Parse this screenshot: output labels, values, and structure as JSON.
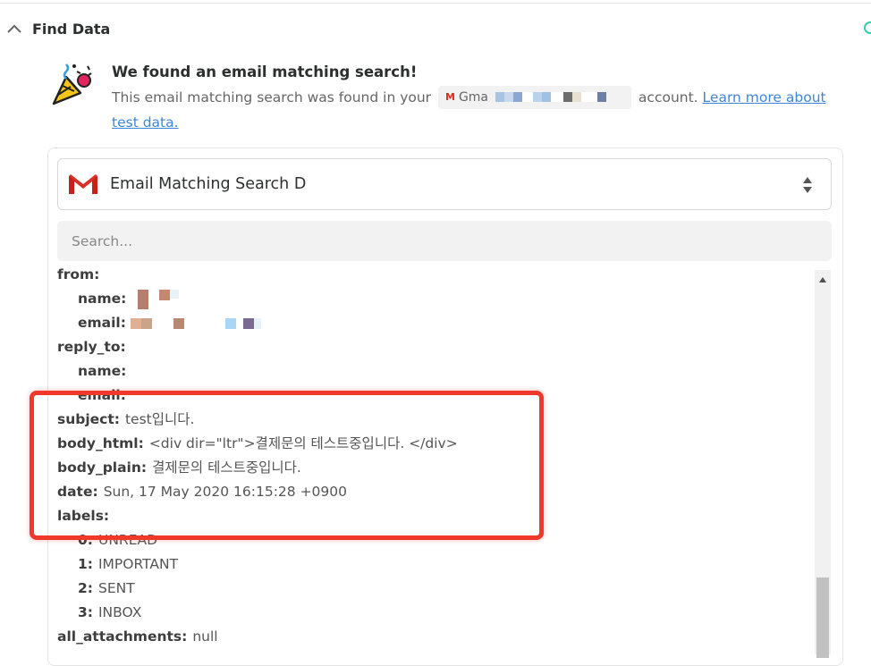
{
  "section": {
    "title": "Find Data"
  },
  "result": {
    "title": "We found an email matching search!",
    "desc_before": "This email matching search was found in your",
    "account_prefix": "Gma",
    "desc_after": "account.",
    "learn_more": "Learn more about test data."
  },
  "select": {
    "label": "Email Matching Search D"
  },
  "search": {
    "placeholder": "Search..."
  },
  "fields": {
    "from": "from:",
    "from_name": "name:",
    "from_email": "email:",
    "reply_to": "reply_to:",
    "reply_name": "name:",
    "reply_email": "email:",
    "subject_key": "subject:",
    "subject_val": "test입니다.",
    "body_html_key": "body_html:",
    "body_html_val": "<div dir=\"ltr\">결제문의 테스트중입니다. </div>",
    "body_plain_key": "body_plain:",
    "body_plain_val": "결제문의 테스트중입니다.",
    "date_key": "date:",
    "date_val": "Sun, 17 May 2020 16:15:28 +0900",
    "labels_key": "labels:",
    "label0_key": "0:",
    "label0_val": "UNREAD",
    "label1_key": "1:",
    "label1_val": "IMPORTANT",
    "label2_key": "2:",
    "label2_val": "SENT",
    "label3_key": "3:",
    "label3_val": "INBOX",
    "attachments_key": "all_attachments:",
    "attachments_val": "null"
  },
  "colors": {
    "accent_link": "#3d87d8",
    "highlight": "#f0392b",
    "status": "#2ecfa8",
    "gmail_red": "#d93025"
  }
}
